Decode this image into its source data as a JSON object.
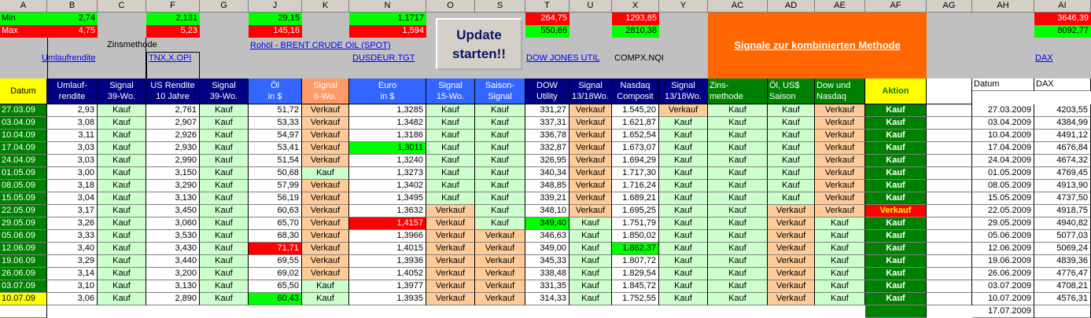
{
  "columns": [
    "A",
    "B",
    "C",
    "F",
    "G",
    "J",
    "K",
    "N",
    "O",
    "S",
    "T",
    "U",
    "X",
    "Y",
    "AC",
    "AD",
    "AE",
    "AF",
    "AG",
    "AH",
    "AI"
  ],
  "colors": {
    "kauf": "#ccffcc",
    "verkauf": "#ffcc99",
    "kauf_aktion": "#008000",
    "verkauf_aktion": "#ff0000",
    "hi_green": "#00ff00",
    "hi_red": "#ff0000",
    "datum_green": "#008000",
    "datum_yellow": "#ffff00",
    "header_navy": "#000080",
    "header_blue": "#3366ff",
    "header_peach": "#ff9966",
    "header_green": "#008000",
    "header_yellow": "#ffff00",
    "orange": "#ff6600"
  },
  "minmax": {
    "min_label": "Min",
    "max_label": "Max",
    "b_min": "2,74",
    "b_max": "4,75",
    "f_min": "2,131",
    "f_max": "5,23",
    "j_min": "29,15",
    "j_max": "145,16",
    "n_min": "1,1717",
    "n_max": "1,594",
    "t_min": "264,75",
    "t_max": "550,66",
    "x_min": "1293,85",
    "x_max": "2810,38",
    "ai_min": "3646,39",
    "ai_max": "8092,77"
  },
  "top": {
    "zinsmethode": "Zinsmethode",
    "umlaufrendite_link": "Umlaufrendite",
    "tnx_link": "TNX.X.OPI",
    "brent_link": "Rohöl - BRENT CRUDE OIL (SPOT)",
    "dusdeur_link": "DUSDEUR.TGT",
    "update_btn": "Update starten!!",
    "dow_link": "DOW JONES UTIL",
    "compx_text": "COMPX.NQI",
    "signale_label": "Signale zur kombinierten Methode",
    "dax_link": "DAX"
  },
  "table_headers": [
    "Datum",
    "Umlauf-\nrendite",
    "Signal\n39-Wo.",
    "US Rendite\n10 Jahre",
    "Signal\n39-Wo.",
    "Öl\nin $",
    "Signal\n6-Wo.",
    "Euro\nin $",
    "Signal\n15-Wo.",
    "Saison-\nSignal",
    "DOW\nUtility",
    "Signal\n13/18Wo.",
    "Nasdaq\nComposit",
    "Signal\n13/18Wo.",
    "Zins-\nmethode",
    "Öl, US$\nSaison",
    "Dow und\nNasdaq",
    "Aktion"
  ],
  "right_headers": {
    "datum": "Datum",
    "dax": "DAX"
  },
  "rows": [
    [
      "27.03.09",
      "2,93",
      "Kauf",
      "2,761",
      "Kauf",
      "51,72",
      "Verkauf",
      "1,3285",
      "Kauf",
      "Kauf",
      "331,27",
      "Verkauf",
      "1.545,20",
      "Verkauf",
      "Kauf",
      "Kauf",
      "Verkauf",
      "Kauf"
    ],
    [
      "03.04.09",
      "3,08",
      "Kauf",
      "2,907",
      "Kauf",
      "53,33",
      "Verkauf",
      "1,3482",
      "Kauf",
      "Kauf",
      "337,31",
      "Verkauf",
      "1.621,87",
      "Kauf",
      "Kauf",
      "Kauf",
      "Verkauf",
      "Kauf"
    ],
    [
      "10.04.09",
      "3,11",
      "Kauf",
      "2,926",
      "Kauf",
      "54,97",
      "Verkauf",
      "1,3186",
      "Kauf",
      "Kauf",
      "336,78",
      "Verkauf",
      "1.652,54",
      "Kauf",
      "Kauf",
      "Kauf",
      "Verkauf",
      "Kauf"
    ],
    [
      "17.04.09",
      "3,03",
      "Kauf",
      "2,930",
      "Kauf",
      "53,41",
      "Verkauf",
      "1,3011",
      "Kauf",
      "Kauf",
      "332,87",
      "Verkauf",
      "1.673,07",
      "Kauf",
      "Kauf",
      "Kauf",
      "Verkauf",
      "Kauf"
    ],
    [
      "24.04.09",
      "3,03",
      "Kauf",
      "2,990",
      "Kauf",
      "51,54",
      "Verkauf",
      "1,3240",
      "Kauf",
      "Kauf",
      "326,95",
      "Verkauf",
      "1.694,29",
      "Kauf",
      "Kauf",
      "Kauf",
      "Verkauf",
      "Kauf"
    ],
    [
      "01.05.09",
      "3,00",
      "Kauf",
      "3,150",
      "Kauf",
      "50,68",
      "Kauf",
      "1,3273",
      "Kauf",
      "Kauf",
      "340,34",
      "Verkauf",
      "1.717,30",
      "Kauf",
      "Kauf",
      "Kauf",
      "Verkauf",
      "Kauf"
    ],
    [
      "08.05.09",
      "3,18",
      "Kauf",
      "3,290",
      "Kauf",
      "57,99",
      "Verkauf",
      "1,3402",
      "Kauf",
      "Kauf",
      "348,85",
      "Verkauf",
      "1.716,24",
      "Kauf",
      "Kauf",
      "Kauf",
      "Verkauf",
      "Kauf"
    ],
    [
      "15.05.09",
      "3,04",
      "Kauf",
      "3,130",
      "Kauf",
      "56,19",
      "Verkauf",
      "1,3495",
      "Kauf",
      "Kauf",
      "339,21",
      "Verkauf",
      "1.689,21",
      "Kauf",
      "Kauf",
      "Kauf",
      "Verkauf",
      "Kauf"
    ],
    [
      "22.05.09",
      "3,17",
      "Kauf",
      "3,450",
      "Kauf",
      "60,63",
      "Verkauf",
      "1,3632",
      "Verkauf",
      "Kauf",
      "348,10",
      "Verkauf",
      "1.695,25",
      "Kauf",
      "Kauf",
      "Verkauf",
      "Verkauf",
      "Verkauf"
    ],
    [
      "29.05.09",
      "3,26",
      "Kauf",
      "3,060",
      "Kauf",
      "65,70",
      "Verkauf",
      "1,4157",
      "Verkauf",
      "Kauf",
      "349,40",
      "Kauf",
      "1.751,79",
      "Kauf",
      "Kauf",
      "Verkauf",
      "Kauf",
      "Kauf"
    ],
    [
      "05.06.09",
      "3,33",
      "Kauf",
      "3,530",
      "Kauf",
      "68,30",
      "Verkauf",
      "1,3966",
      "Verkauf",
      "Verkauf",
      "346,63",
      "Kauf",
      "1.850,02",
      "Kauf",
      "Kauf",
      "Verkauf",
      "Kauf",
      "Kauf"
    ],
    [
      "12.06.09",
      "3,40",
      "Kauf",
      "3,430",
      "Kauf",
      "71,71",
      "Verkauf",
      "1,4015",
      "Verkauf",
      "Verkauf",
      "349,00",
      "Kauf",
      "1.862,37",
      "Kauf",
      "Kauf",
      "Verkauf",
      "Kauf",
      "Kauf"
    ],
    [
      "19.06.09",
      "3,29",
      "Kauf",
      "3,440",
      "Kauf",
      "69,55",
      "Verkauf",
      "1,3936",
      "Verkauf",
      "Verkauf",
      "345,33",
      "Kauf",
      "1.807,72",
      "Kauf",
      "Kauf",
      "Verkauf",
      "Kauf",
      "Kauf"
    ],
    [
      "26.06.09",
      "3,14",
      "Kauf",
      "3,200",
      "Kauf",
      "69,02",
      "Verkauf",
      "1,4052",
      "Verkauf",
      "Verkauf",
      "338,48",
      "Kauf",
      "1.829,54",
      "Kauf",
      "Kauf",
      "Verkauf",
      "Kauf",
      "Kauf"
    ],
    [
      "03.07.09",
      "3,10",
      "Kauf",
      "3,130",
      "Kauf",
      "65,50",
      "Kauf",
      "1,3977",
      "Verkauf",
      "Verkauf",
      "331,35",
      "Kauf",
      "1.845,72",
      "Kauf",
      "Kauf",
      "Verkauf",
      "Kauf",
      "Kauf"
    ],
    [
      "10.07.09",
      "3,06",
      "Kauf",
      "2,890",
      "Kauf",
      "60,43",
      "Kauf",
      "1,3935",
      "Verkauf",
      "Verkauf",
      "314,33",
      "Kauf",
      "1.752,55",
      "Kauf",
      "Kauf",
      "Verkauf",
      "Kauf",
      "Kauf"
    ]
  ],
  "dax_rows": [
    [
      "27.03.2009",
      "4203,55"
    ],
    [
      "03.04.2009",
      "4384,99"
    ],
    [
      "10.04.2009",
      "4491,12"
    ],
    [
      "17.04.2009",
      "4676,84"
    ],
    [
      "24.04.2009",
      "4674,32"
    ],
    [
      "01.05.2009",
      "4769,45"
    ],
    [
      "08.05.2009",
      "4913,90"
    ],
    [
      "15.05.2009",
      "4737,50"
    ],
    [
      "22.05.2009",
      "4918,75"
    ],
    [
      "29.05.2009",
      "4940,82"
    ],
    [
      "05.06.2009",
      "5077,03"
    ],
    [
      "12.06.2009",
      "5069,24"
    ],
    [
      "19.06.2009",
      "4839,36"
    ],
    [
      "26.06.2009",
      "4776,47"
    ],
    [
      "03.07.2009",
      "4708,21"
    ],
    [
      "10.07.2009",
      "4576,31"
    ],
    [
      "17.07.2009",
      ""
    ]
  ]
}
